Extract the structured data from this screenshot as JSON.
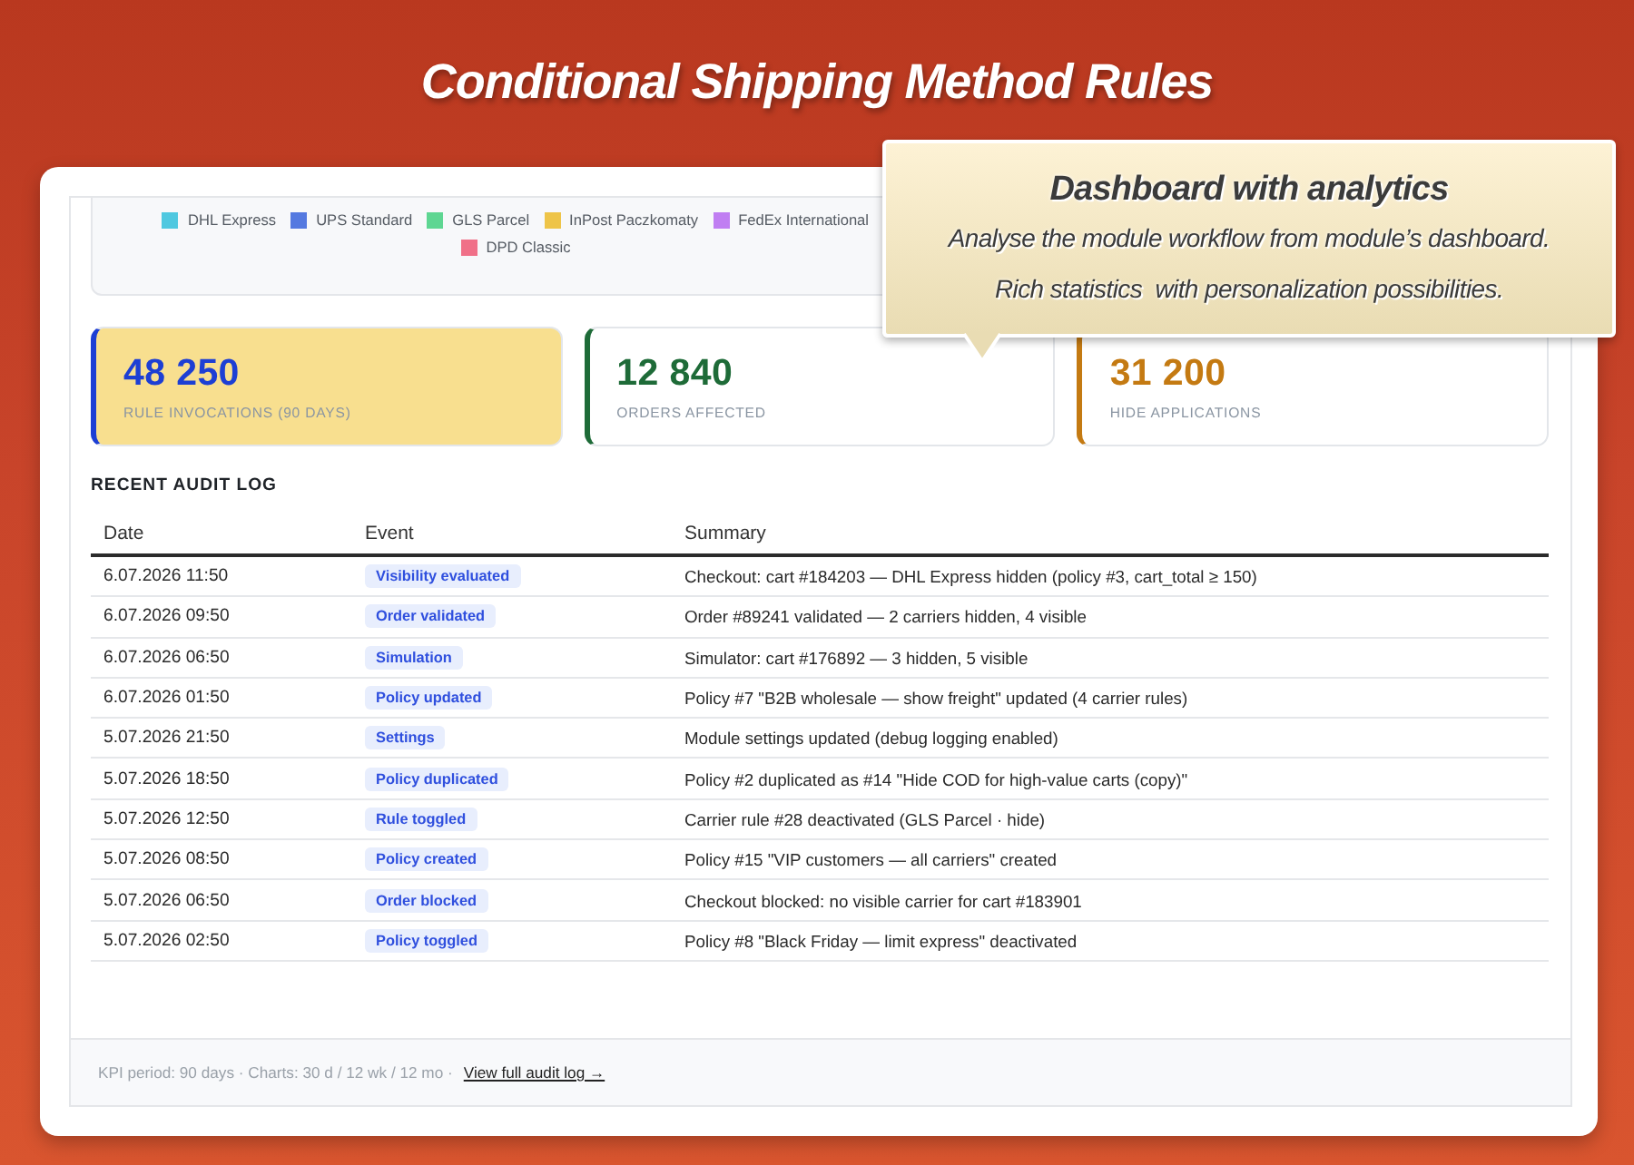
{
  "page_title": "Conditional Shipping Method Rules",
  "chart_legend": [
    {
      "label": "DHL Express",
      "color": "#4fc8e0"
    },
    {
      "label": "UPS Standard",
      "color": "#5479e0"
    },
    {
      "label": "GLS Parcel",
      "color": "#5ed692"
    },
    {
      "label": "InPost Paczkomaty",
      "color": "#eec448"
    },
    {
      "label": "FedEx International",
      "color": "#c07ef2"
    },
    {
      "label": "DPD Classic",
      "color": "#f07088"
    }
  ],
  "kpis": [
    {
      "value": "48 250",
      "label": "RULE INVOCATIONS (90 DAYS)",
      "color": "#1d3fd4",
      "highlighted": true
    },
    {
      "value": "12 840",
      "label": "ORDERS AFFECTED",
      "color": "#1e6b38",
      "highlighted": false
    },
    {
      "value": "31 200",
      "label": "HIDE APPLICATIONS",
      "color": "#c47a12",
      "highlighted": false
    }
  ],
  "audit_log": {
    "title": "RECENT AUDIT LOG",
    "columns": [
      "Date",
      "Event",
      "Summary"
    ],
    "rows": [
      {
        "date": "6.07.2026 11:50",
        "event": "Visibility evaluated",
        "summary": "Checkout: cart #184203 — DHL Express hidden (policy #3, cart_total ≥ 150)"
      },
      {
        "date": "6.07.2026 09:50",
        "event": "Order validated",
        "summary": "Order #89241 validated — 2 carriers hidden, 4 visible"
      },
      {
        "date": "6.07.2026 06:50",
        "event": "Simulation",
        "summary": "Simulator: cart #176892 — 3 hidden, 5 visible"
      },
      {
        "date": "6.07.2026 01:50",
        "event": "Policy updated",
        "summary": "Policy #7 \"B2B wholesale — show freight\" updated (4 carrier rules)"
      },
      {
        "date": "5.07.2026 21:50",
        "event": "Settings",
        "summary": "Module settings updated (debug logging enabled)"
      },
      {
        "date": "5.07.2026 18:50",
        "event": "Policy duplicated",
        "summary": "Policy #2 duplicated as #14 \"Hide COD for high-value carts (copy)\""
      },
      {
        "date": "5.07.2026 12:50",
        "event": "Rule toggled",
        "summary": "Carrier rule #28 deactivated (GLS Parcel · hide)"
      },
      {
        "date": "5.07.2026 08:50",
        "event": "Policy created",
        "summary": "Policy #15 \"VIP customers — all carriers\" created"
      },
      {
        "date": "5.07.2026 06:50",
        "event": "Order blocked",
        "summary": "Checkout blocked: no visible carrier for cart #183901"
      },
      {
        "date": "5.07.2026 02:50",
        "event": "Policy toggled",
        "summary": "Policy #8 \"Black Friday — limit express\" deactivated"
      }
    ]
  },
  "footer": {
    "note": "KPI period: 90 days · Charts: 30 d / 12 wk / 12 mo ·",
    "link": "View full audit log →"
  },
  "callout": {
    "title": "Dashboard with analytics",
    "lines": [
      "Analyse the module workflow from module’s dashboard.",
      "Rich statistics  with personalization possibilities."
    ]
  }
}
